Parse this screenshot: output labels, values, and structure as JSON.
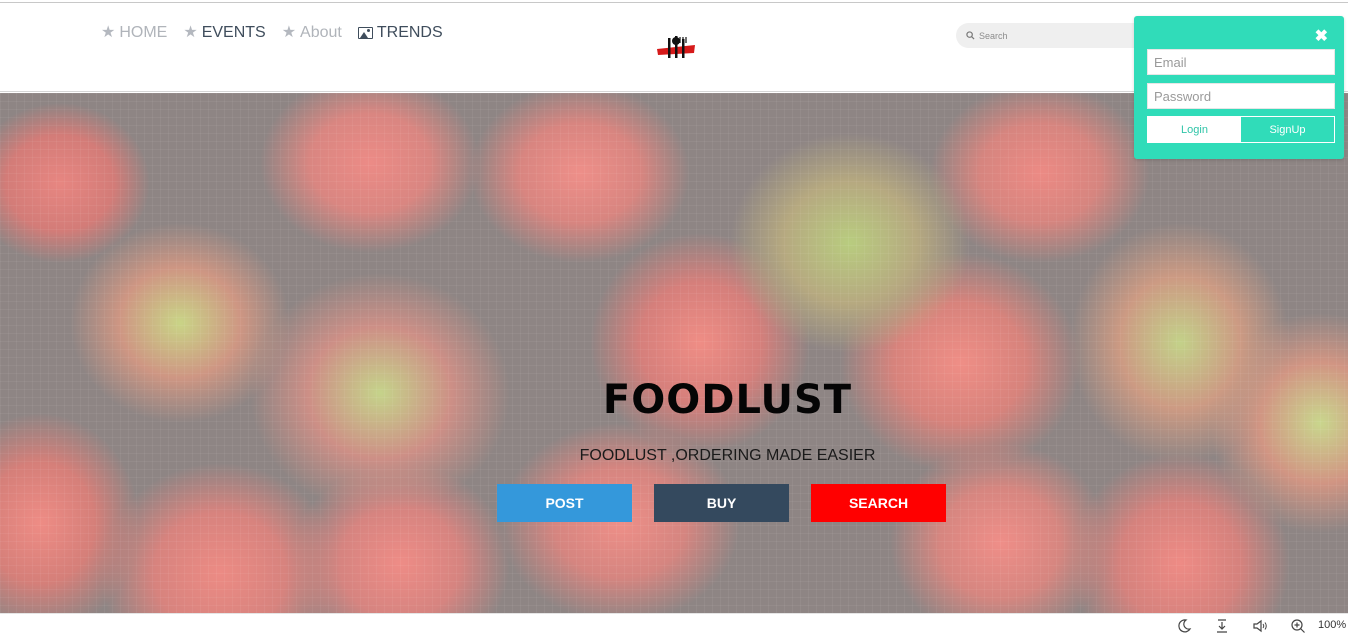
{
  "nav": {
    "items": [
      {
        "label": "HOME",
        "icon": "star-icon"
      },
      {
        "label": "EVENTS",
        "icon": "star-icon"
      },
      {
        "label": "About",
        "icon": "star-icon"
      },
      {
        "label": "TRENDS",
        "icon": "image-icon"
      }
    ]
  },
  "search": {
    "placeholder": "Search"
  },
  "login": {
    "close_icon": "close-icon",
    "email_placeholder": "Email",
    "password_placeholder": "Password",
    "login_label": "Login",
    "signup_label": "SignUp",
    "accent_color": "#30dcb9"
  },
  "hero": {
    "title": "FOODLUST",
    "subtitle": "FOODLUST ,ORDERING MADE EASIER",
    "buttons": {
      "post": "POST",
      "buy": "BUY",
      "search": "SEARCH"
    },
    "colors": {
      "post": "#3498db",
      "buy": "#34495e",
      "search": "#ff0000"
    }
  },
  "statusbar": {
    "icons": [
      "moon-icon",
      "download-icon",
      "speaker-icon",
      "zoom-icon"
    ],
    "zoom": "100%"
  }
}
